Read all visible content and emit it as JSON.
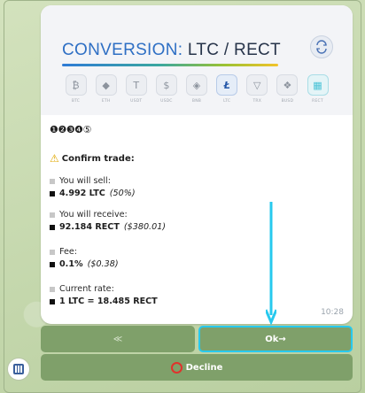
{
  "header": {
    "title_prefix": "CONVERSION:",
    "title_pair": "LTC / RECT"
  },
  "coins": [
    {
      "symbol": "BTC",
      "glyph": "₿"
    },
    {
      "symbol": "ETH",
      "glyph": "◆"
    },
    {
      "symbol": "USDT",
      "glyph": "T"
    },
    {
      "symbol": "USDC",
      "glyph": "$"
    },
    {
      "symbol": "BNB",
      "glyph": "◈"
    },
    {
      "symbol": "LTC",
      "glyph": "Ł"
    },
    {
      "symbol": "TRX",
      "glyph": "▽"
    },
    {
      "symbol": "BUSD",
      "glyph": "❖"
    },
    {
      "symbol": "RECT",
      "glyph": "▦"
    }
  ],
  "active_coin": "LTC",
  "steps": "❶❷❸❹⑤",
  "confirm_title": "Confirm trade:",
  "sell": {
    "label": "You will sell:",
    "value": "4.992 LTC",
    "sub": "(50%)"
  },
  "receive": {
    "label": "You will receive:",
    "value": "92.184 RECT",
    "sub": "($380.01)"
  },
  "fee": {
    "label": "Fee:",
    "value": "0.1%",
    "sub": "($0.38)"
  },
  "rate": {
    "label": "Current rate:",
    "value": "1 LTC = 18.485 RECT"
  },
  "timestamp": "10:28",
  "buttons": {
    "back": "≪",
    "ok": "Ok→",
    "decline": "Decline"
  },
  "colors": {
    "accent": "#2e6fc4",
    "button_bg": "#7fa06a",
    "highlight": "#27c9ee",
    "decline_ring": "#e0322c"
  }
}
